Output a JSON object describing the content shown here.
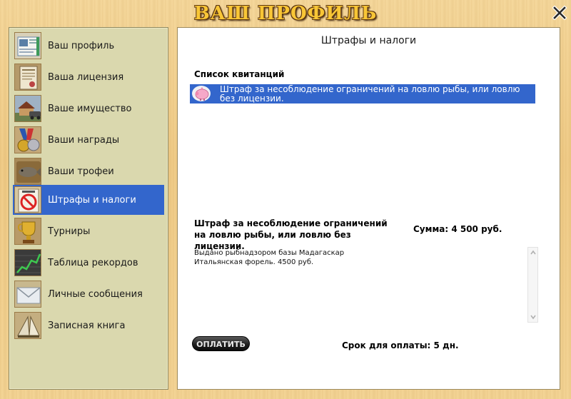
{
  "window": {
    "title": "ВАШ ПРОФИЛЬ",
    "close_label": "close"
  },
  "sidebar": {
    "items": [
      {
        "label": "Ваш профиль",
        "icon": "profile-icon",
        "active": false
      },
      {
        "label": "Ваша лицензия",
        "icon": "license-icon",
        "active": false
      },
      {
        "label": "Ваше имущество",
        "icon": "property-icon",
        "active": false
      },
      {
        "label": "Ваши награды",
        "icon": "medal-icon",
        "active": false
      },
      {
        "label": "Ваши трофеи",
        "icon": "trophy-fish-icon",
        "active": false
      },
      {
        "label": "Штрафы и налоги",
        "icon": "fines-icon",
        "active": true
      },
      {
        "label": "Турниры",
        "icon": "cup-icon",
        "active": false
      },
      {
        "label": "Таблица рекордов",
        "icon": "chart-icon",
        "active": false
      },
      {
        "label": "Личные сообщения",
        "icon": "envelope-icon",
        "active": false
      },
      {
        "label": "Записная книга",
        "icon": "notebook-icon",
        "active": false
      }
    ]
  },
  "main": {
    "title": "Штрафы и налоги",
    "list_header": "Список квитанций",
    "receipts": [
      {
        "text": "Штраф за несоблюдение ограничений на ловлю рыбы, или ловлю без лицензии.",
        "icon": "piggy-bank-icon"
      }
    ],
    "detail": {
      "title": "Штраф за несоблюдение ограничений на ловлю рыбы, или ловлю без лицензии.",
      "sum": "Сумма: 4 500 руб.",
      "line1": "Выдано рыбнадзором базы Мадагаскар",
      "line2": "Итальянская форель. 4500 руб."
    },
    "pay_button": "ОПЛАТИТЬ",
    "deadline": "Срок для оплаты: 5 дн."
  },
  "colors": {
    "accent": "#3366cc",
    "sidebar_bg": "#dad8ae",
    "title": "#f8c636"
  }
}
